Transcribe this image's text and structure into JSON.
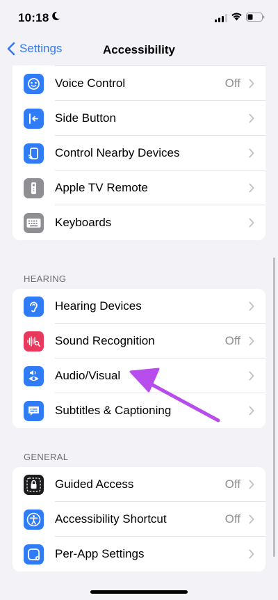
{
  "status": {
    "time": "10:18"
  },
  "nav": {
    "back_label": "Settings",
    "title": "Accessibility"
  },
  "sections": {
    "interaction": {
      "rows": [
        {
          "label": "Voice Control",
          "value": "Off",
          "icon": "voice-control-icon",
          "color": "#2f7cf6"
        },
        {
          "label": "Side Button",
          "value": "",
          "icon": "side-button-icon",
          "color": "#2f7cf6"
        },
        {
          "label": "Control Nearby Devices",
          "value": "",
          "icon": "nearby-devices-icon",
          "color": "#2f7cf6"
        },
        {
          "label": "Apple TV Remote",
          "value": "",
          "icon": "tv-remote-icon",
          "color": "#8e8e93"
        },
        {
          "label": "Keyboards",
          "value": "",
          "icon": "keyboard-icon",
          "color": "#8e8e93"
        }
      ]
    },
    "hearing": {
      "header": "HEARING",
      "rows": [
        {
          "label": "Hearing Devices",
          "value": "",
          "icon": "ear-icon",
          "color": "#2f7cf6"
        },
        {
          "label": "Sound Recognition",
          "value": "Off",
          "icon": "sound-recognition-icon",
          "color": "#e8395c"
        },
        {
          "label": "Audio/Visual",
          "value": "",
          "icon": "audio-visual-icon",
          "color": "#2f7cf6"
        },
        {
          "label": "Subtitles & Captioning",
          "value": "",
          "icon": "subtitles-icon",
          "color": "#2f7cf6"
        }
      ]
    },
    "general": {
      "header": "GENERAL",
      "rows": [
        {
          "label": "Guided Access",
          "value": "Off",
          "icon": "guided-access-icon",
          "color": "#1c1c1e"
        },
        {
          "label": "Accessibility Shortcut",
          "value": "Off",
          "icon": "accessibility-icon",
          "color": "#2f7cf6"
        },
        {
          "label": "Per-App Settings",
          "value": "",
          "icon": "per-app-icon",
          "color": "#2f7cf6"
        }
      ]
    }
  },
  "colors": {
    "accent": "#3478f6",
    "annotation_arrow": "#b84dee"
  }
}
